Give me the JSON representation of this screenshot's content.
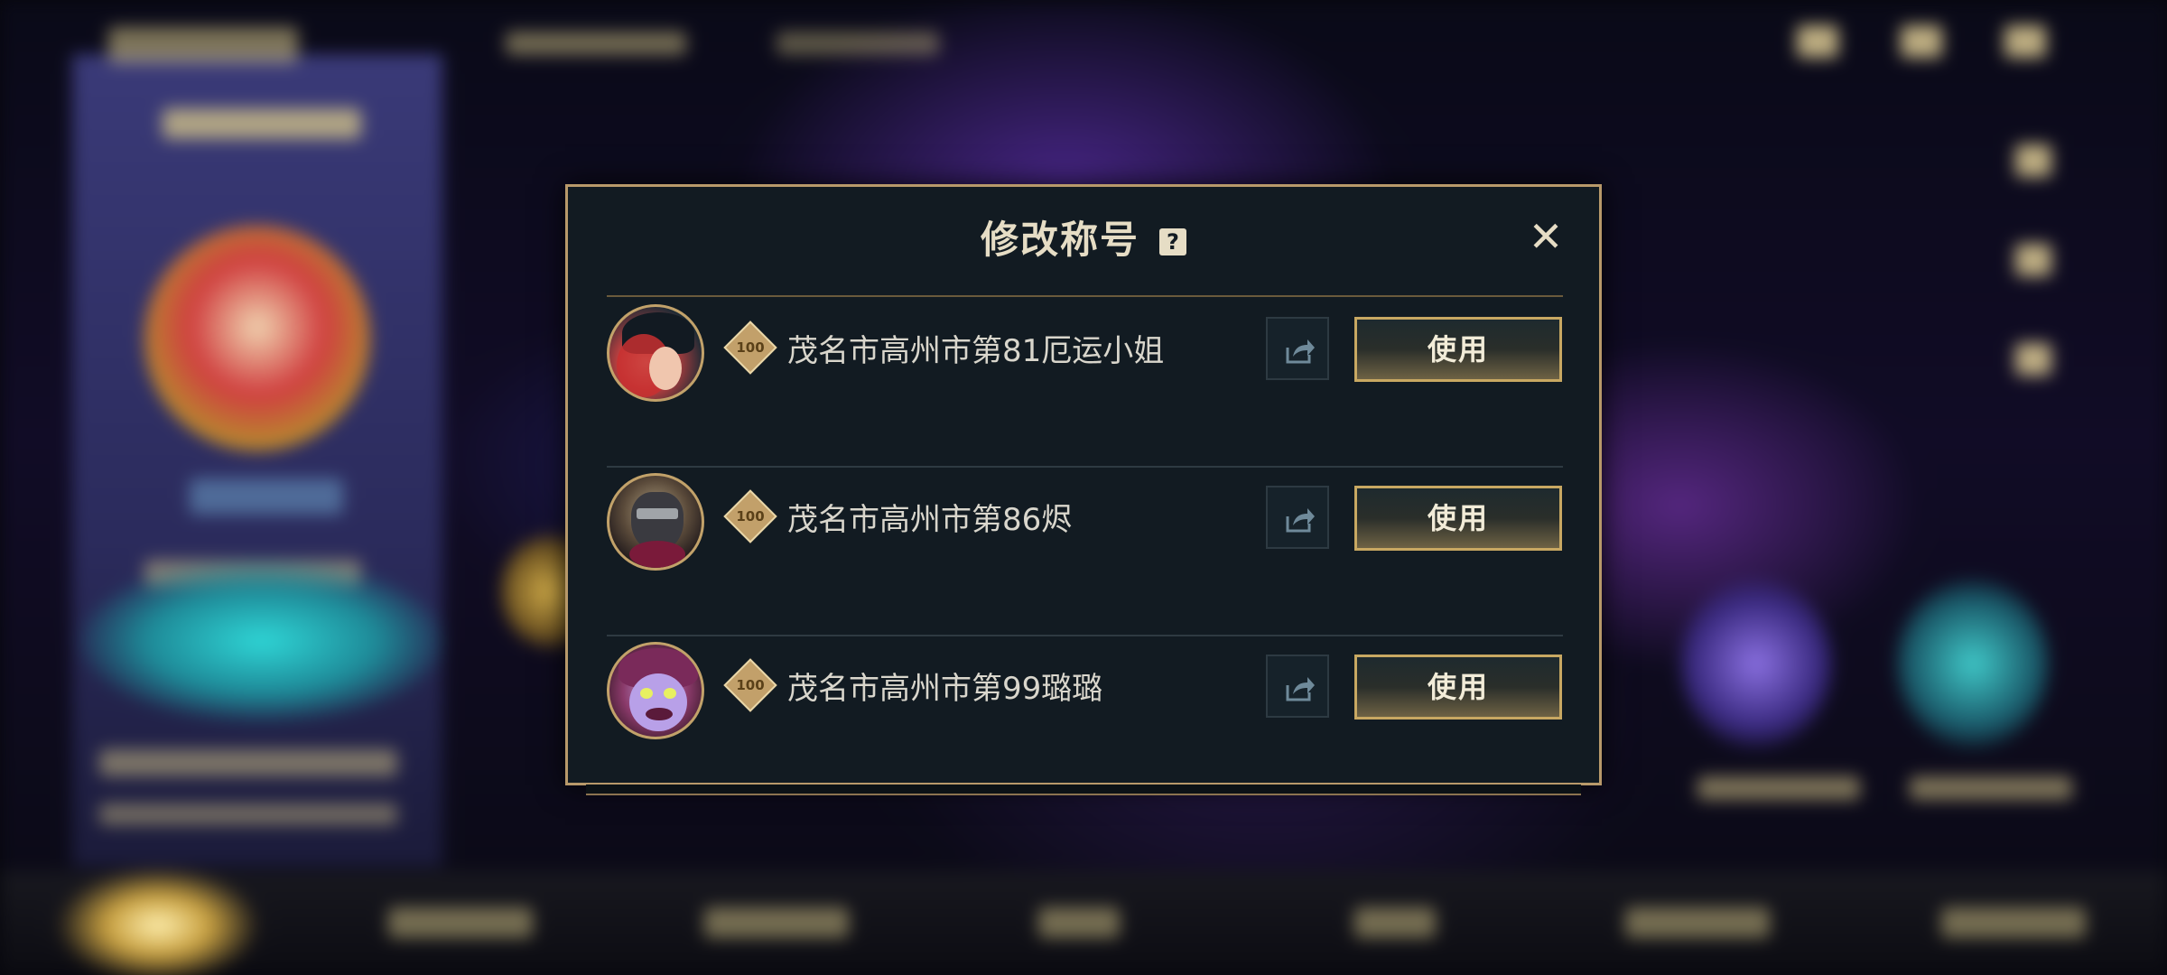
{
  "modal": {
    "title": "修改称号",
    "help_icon": "?",
    "close_icon": "✕",
    "titles": [
      {
        "level": "100",
        "name": "茂名市高州市第81厄运小姐",
        "use_label": "使用",
        "avatar": "miss-fortune-avatar"
      },
      {
        "level": "100",
        "name": "茂名市高州市第86烬",
        "use_label": "使用",
        "avatar": "jhin-avatar"
      },
      {
        "level": "100",
        "name": "茂名市高州市第99璐璐",
        "use_label": "使用",
        "avatar": "lulu-avatar"
      }
    ]
  },
  "colors": {
    "modal_border": "#b8996a",
    "modal_bg": "#121b22",
    "text": "#d9d6cc",
    "button_border": "#c8a862"
  }
}
